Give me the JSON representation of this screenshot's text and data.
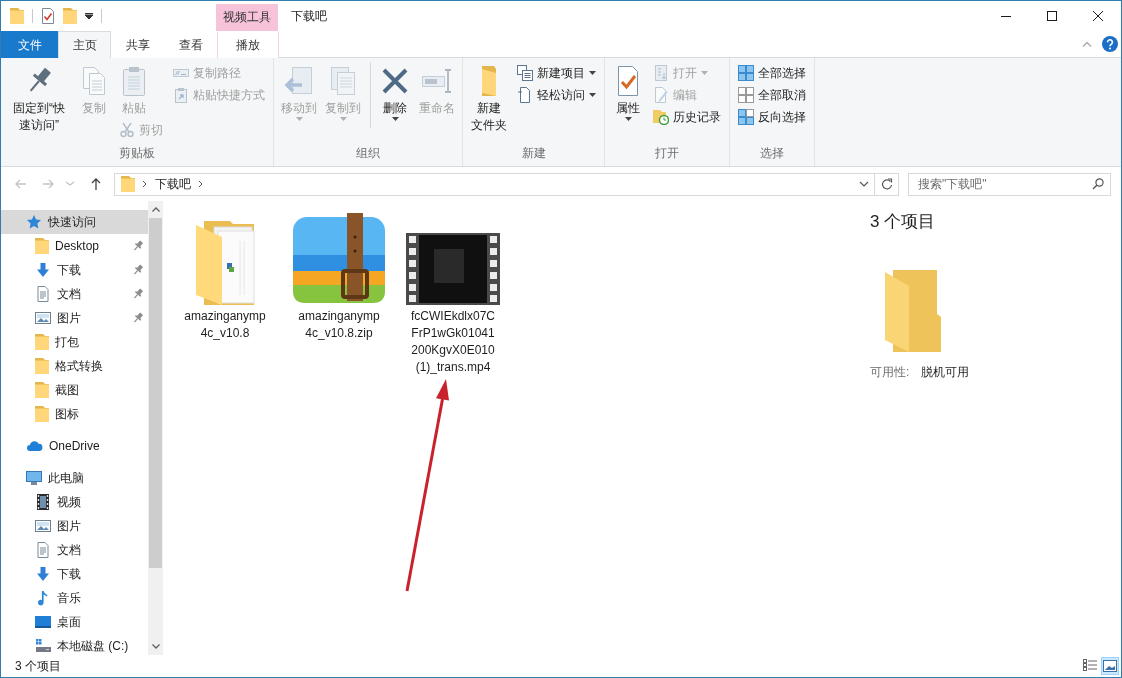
{
  "window": {
    "context_tab_group": "视频工具",
    "title": "下载吧"
  },
  "ribbon": {
    "tabs": [
      {
        "label": "文件",
        "kind": "file",
        "selected": false
      },
      {
        "label": "主页",
        "kind": "normal",
        "selected": true
      },
      {
        "label": "共享",
        "kind": "normal",
        "selected": false
      },
      {
        "label": "查看",
        "kind": "normal",
        "selected": false
      },
      {
        "label": "播放",
        "kind": "context",
        "selected": false
      }
    ],
    "groups": [
      {
        "label": "剪贴板",
        "columns": [
          {
            "buttons": [
              {
                "label": "固定到“快速访问”",
                "kind": "large",
                "disabled": false,
                "dropdown": false
              }
            ]
          },
          {
            "buttons": [
              {
                "label": "复制",
                "kind": "large",
                "disabled": true,
                "dropdown": false
              }
            ]
          },
          {
            "buttons": [
              {
                "label": "粘贴",
                "kind": "large",
                "disabled": true,
                "dropdown": false
              },
              {
                "label": "剪切",
                "kind": "small",
                "disabled": true,
                "dropdown": false
              }
            ]
          },
          {
            "buttons": [
              {
                "label": "复制路径",
                "kind": "small",
                "disabled": true,
                "dropdown": false
              },
              {
                "label": "粘贴快捷方式",
                "kind": "small",
                "disabled": true,
                "dropdown": false
              }
            ]
          }
        ]
      },
      {
        "label": "组织",
        "columns": [
          {
            "divider_before": false,
            "buttons": [
              {
                "label": "移动到",
                "kind": "large",
                "disabled": true,
                "dropdown": true
              }
            ]
          },
          {
            "divider_before": false,
            "buttons": [
              {
                "label": "复制到",
                "kind": "large",
                "disabled": true,
                "dropdown": true
              }
            ]
          },
          {
            "divider_before": true,
            "buttons": [
              {
                "label": "删除",
                "kind": "large",
                "disabled": false,
                "dropdown": true
              }
            ]
          },
          {
            "divider_before": false,
            "buttons": [
              {
                "label": "重命名",
                "kind": "large",
                "disabled": true,
                "dropdown": false
              }
            ]
          }
        ]
      },
      {
        "label": "新建",
        "columns": [
          {
            "buttons": [
              {
                "label": "新建文件夹",
                "kind": "large",
                "disabled": false,
                "dropdown": false
              }
            ]
          },
          {
            "buttons": [
              {
                "label": "新建项目",
                "kind": "small",
                "disabled": false,
                "dropdown": true
              },
              {
                "label": "轻松访问",
                "kind": "small",
                "disabled": false,
                "dropdown": true
              }
            ]
          }
        ]
      },
      {
        "label": "打开",
        "columns": [
          {
            "buttons": [
              {
                "label": "属性",
                "kind": "large",
                "disabled": false,
                "dropdown": true
              }
            ]
          },
          {
            "buttons": [
              {
                "label": "打开",
                "kind": "small",
                "disabled": true,
                "dropdown": true
              },
              {
                "label": "编辑",
                "kind": "small",
                "disabled": true,
                "dropdown": false
              },
              {
                "label": "历史记录",
                "kind": "small",
                "disabled": false,
                "dropdown": false
              }
            ]
          }
        ]
      },
      {
        "label": "选择",
        "columns": [
          {
            "buttons": [
              {
                "label": "全部选择",
                "kind": "small",
                "disabled": false,
                "dropdown": false
              },
              {
                "label": "全部取消",
                "kind": "small",
                "disabled": false,
                "dropdown": false
              },
              {
                "label": "反向选择",
                "kind": "small",
                "disabled": false,
                "dropdown": false
              }
            ]
          }
        ]
      }
    ]
  },
  "address_bar": {
    "nav_buttons": [
      {
        "kind": "back",
        "disabled": true
      },
      {
        "kind": "forward",
        "disabled": true
      },
      {
        "kind": "recent",
        "disabled": true
      },
      {
        "kind": "up",
        "disabled": false
      }
    ],
    "path": [
      "下载吧"
    ],
    "search_placeholder": "搜索\"下载吧\""
  },
  "navigation": {
    "items": [
      {
        "label": "快速访问",
        "kind": "quick_access",
        "selected": true,
        "children": [
          {
            "label": "Desktop",
            "kind": "folder",
            "pinned": true,
            "selected": false
          },
          {
            "label": "下载",
            "kind": "downloads",
            "pinned": true,
            "selected": false
          },
          {
            "label": "文档",
            "kind": "documents",
            "pinned": true,
            "selected": false
          },
          {
            "label": "图片",
            "kind": "pictures",
            "pinned": true,
            "selected": false
          },
          {
            "label": "打包",
            "kind": "folder",
            "pinned": false,
            "selected": false
          },
          {
            "label": "格式转换",
            "kind": "folder",
            "pinned": false,
            "selected": false
          },
          {
            "label": "截图",
            "kind": "folder",
            "pinned": false,
            "selected": false
          },
          {
            "label": "图标",
            "kind": "folder",
            "pinned": false,
            "selected": false
          }
        ]
      },
      {
        "label": "OneDrive",
        "kind": "cloud",
        "selected": false
      },
      {
        "label": "此电脑",
        "kind": "computer",
        "selected": false,
        "children": [
          {
            "label": "视频",
            "kind": "video",
            "pinned": false,
            "selected": false
          },
          {
            "label": "图片",
            "kind": "pictures",
            "pinned": false,
            "selected": false
          },
          {
            "label": "文档",
            "kind": "documents",
            "pinned": false,
            "selected": false
          },
          {
            "label": "下载",
            "kind": "downloads",
            "pinned": false,
            "selected": false
          },
          {
            "label": "音乐",
            "kind": "music",
            "pinned": false,
            "selected": false
          },
          {
            "label": "桌面",
            "kind": "desktop",
            "pinned": false,
            "selected": false
          },
          {
            "label": "本地磁盘 (C:)",
            "kind": "drive",
            "pinned": false,
            "selected": false
          }
        ]
      }
    ]
  },
  "files": {
    "items": [
      {
        "name": "amazinganymp4c_v10.8",
        "kind": "folder",
        "selected": false
      },
      {
        "name": "amazinganymp4c_v10.8.zip",
        "kind": "archive",
        "selected": false
      },
      {
        "name": "fcCWIEkdlx07CFrP1wGk01041200KgvX0E010(1)_trans.mp4",
        "kind": "video",
        "selected": false
      }
    ]
  },
  "details_pane": {
    "title": "3 个项目",
    "properties": [
      {
        "label": "可用性:",
        "value": "脱机可用"
      }
    ]
  },
  "status_bar": {
    "text": "3 个项目",
    "views": [
      {
        "kind": "details",
        "selected": false
      },
      {
        "kind": "large_icons",
        "selected": true
      }
    ]
  },
  "annotations": [
    {
      "kind": "arrow"
    }
  ]
}
